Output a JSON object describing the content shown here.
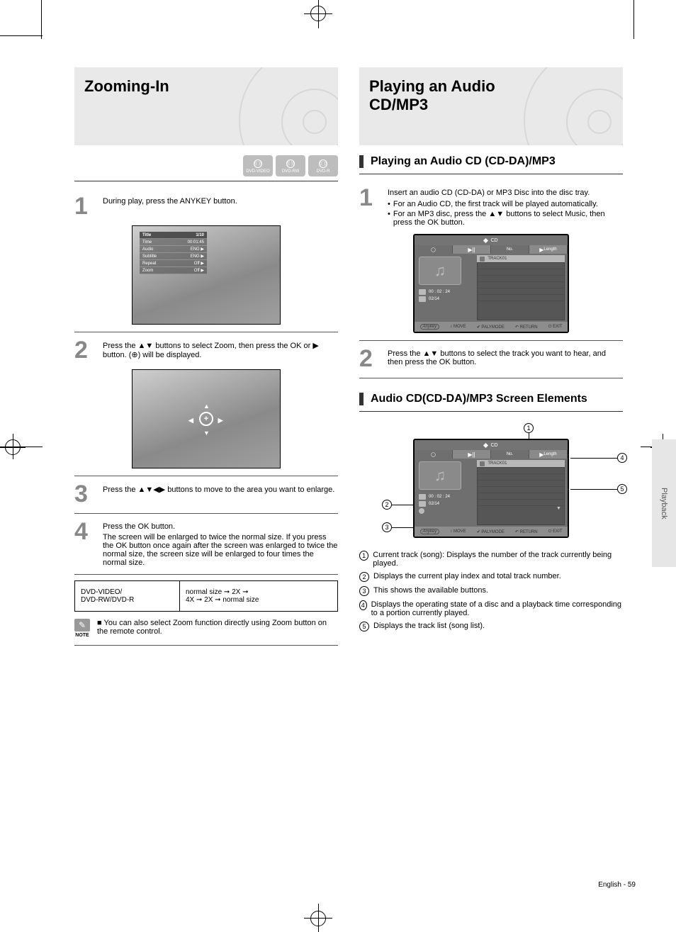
{
  "page": {
    "number": "English - 59"
  },
  "sideTab": "Playback",
  "left": {
    "headerLine1": "Zooming-In",
    "badges": [
      "DVD-VIDEO",
      "DVD-RW",
      "DVD-R"
    ],
    "step1": "During play, press the ANYKEY button.",
    "osd": {
      "title": "Title",
      "rows": [
        "Time",
        "Audio",
        "Subtitle",
        "Repeat",
        "Zoom"
      ],
      "vals": [
        "1/10",
        "00:01:45",
        "ENG",
        "ENG",
        "Off",
        "Off"
      ]
    },
    "step2_a": "Press the ",
    "step2_b": " buttons to select Zoom, then press the OK or ",
    "step2_c": " button. (",
    "step2_d": ") will be displayed.",
    "step3_a": "Press the ",
    "step3_b": " buttons to move to the area you want to enlarge.",
    "step4_a": "Press the OK button.",
    "step4_b": "The screen will be enlarged to twice the normal size. If you press the OK button once again after the screen was enlarged to twice the normal size, the screen size will be enlarged to four times the normal size.",
    "table": {
      "l1a": "DVD-VIDEO/",
      "l1b": "DVD-RW/DVD-R",
      "r1": "normal size ➞ 2X ➞",
      "r2": "4X ➞ 2X ➞ normal size"
    },
    "noteLabel": "NOTE",
    "note": "You can also select Zoom function directly using Zoom button on the remote control."
  },
  "right": {
    "headerLine1": "Playing an Audio",
    "headerLine2": "CD/MP3",
    "sub1": "Playing an Audio CD (CD-DA)/MP3",
    "step1_a": "Insert an audio CD (CD-DA) or MP3 Disc into the disc tray.",
    "step1_b": "For an Audio CD, the first track will be played automatically.",
    "step1_c": "For an MP3 disc, press the ▲▼ buttons to select Music, then press the OK button.",
    "step2_a": "Press the ",
    "step2_b": " buttons to select the track you want to hear, and then press the OK button.",
    "ui": {
      "top": "CD",
      "tabs": {
        "num": "No.",
        "len": "Length"
      },
      "leftRows": [
        "00 : 02 : 24",
        "02/14"
      ],
      "rightHead": "TRACK01",
      "helpers": [
        "MOVE",
        "PALYMODE",
        "RETURN",
        "EXIT"
      ]
    },
    "sub2": "Audio CD(CD-DA)/MP3 Screen Elements",
    "elements": [
      "Current track (song): Displays the number of the track currently being played.",
      "Displays the current play index and total track number.",
      "This shows the available buttons.",
      "Displays the operating state of a disc and a playback time corresponding to a portion currently played.",
      "Displays the track list (song list)."
    ]
  }
}
